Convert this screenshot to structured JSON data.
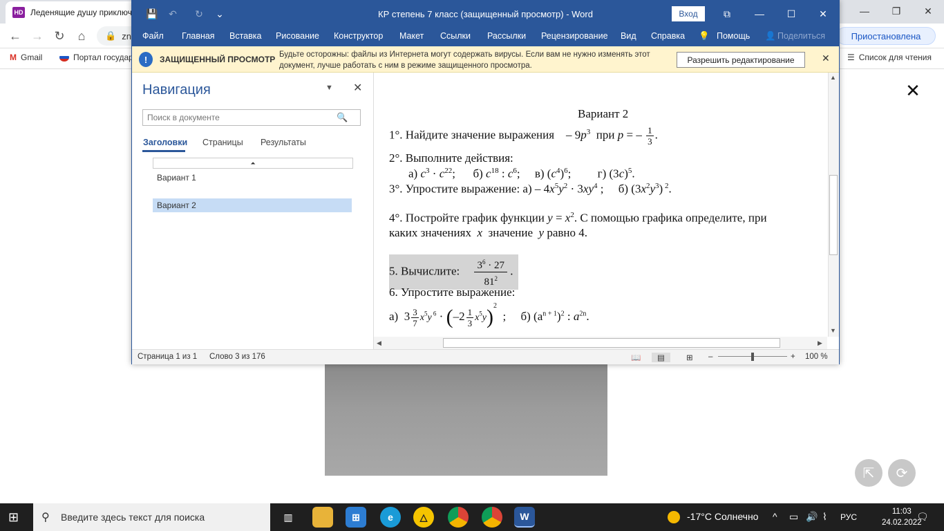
{
  "chrome": {
    "tab_title": "Леденящие душу приключ",
    "tab_favicon": "HD",
    "address_text": "zn",
    "paused_label": "Приостановлена",
    "bookmarks": [
      "Gmail",
      "Портал государ"
    ],
    "reading_list": "Список для чтения"
  },
  "word": {
    "title": "КР степень 7 класс (защищенный просмотр)  -  Word",
    "login_label": "Вход",
    "ribbon_tabs": [
      "Файл",
      "Главная",
      "Вставка",
      "Рисование",
      "Конструктор",
      "Макет",
      "Ссылки",
      "Рассылки",
      "Рецензирование",
      "Вид",
      "Справка",
      "Помощь",
      "Поделиться"
    ],
    "protected_title": "ЗАЩИЩЕННЫЙ ПРОСМОТР",
    "protected_message": "Будьте осторожны: файлы из Интернета могут содержать вирусы. Если вам не нужно изменять этот документ, лучше работать с ним в режиме защищенного просмотра.",
    "allow_editing": "Разрешить редактирование",
    "nav": {
      "title": "Навигация",
      "search_placeholder": "Поиск в документе",
      "tabs": [
        "Заголовки",
        "Страницы",
        "Результаты"
      ],
      "headings": [
        "Вариант 1",
        "Вариант 2"
      ]
    },
    "doc": {
      "heading": "Вариант 2",
      "t1_text": "1°. Найдите значение выражения",
      "t2_text": "2°. Выполните действия:",
      "t3_text": "3°. Упростите выражение: а) – 4",
      "t4_line1": "4°. Постройте график функции",
      "t4_line1b": ". С помощью графика определите, при",
      "t4_line2a": "каких значениях",
      "t4_line2b": "значение",
      "t4_line2c": "равно 4.",
      "t5_text": "5. Вычислите:",
      "t6_text": "6. Упростите выражение:"
    },
    "status": {
      "page": "Страница 1 из 1",
      "words": "Слово 3 из 176",
      "zoom": "100 %"
    }
  },
  "taskbar": {
    "search_placeholder": "Введите здесь текст для поиска",
    "weather": "-17°C  Солнечно",
    "lang": "РУС",
    "time": "11:03",
    "date": "24.02.2022"
  }
}
